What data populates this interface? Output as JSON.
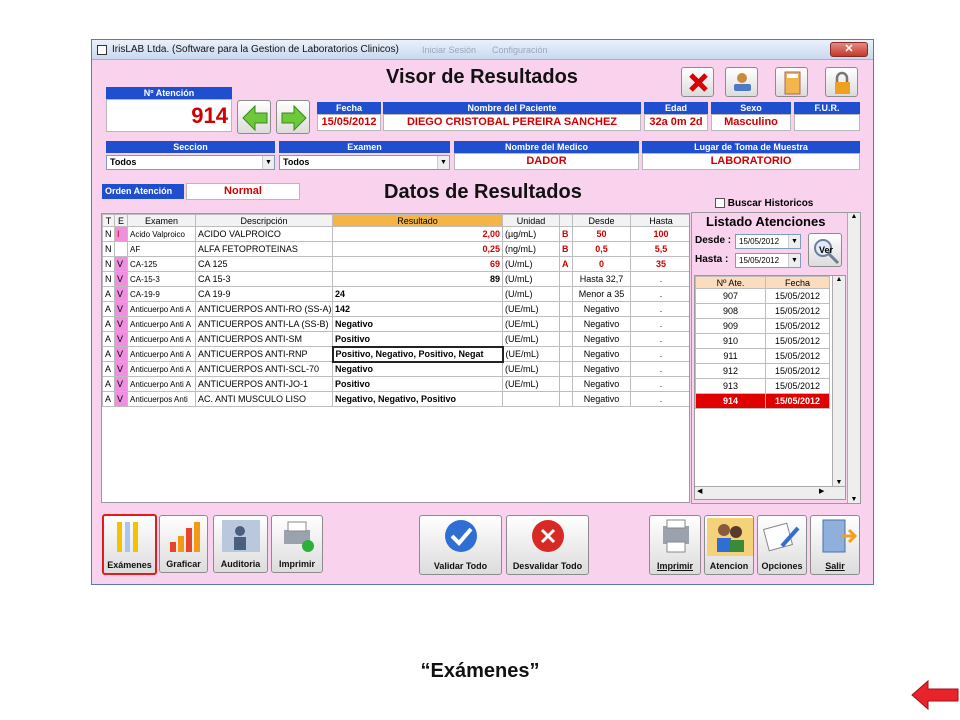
{
  "window": {
    "title": "IrisLAB Ltda. (Software para la Gestion de Laboratorios Clinicos)",
    "faded_1": "Iniciar Sesión",
    "faded_2": "Configuración",
    "close": "✕"
  },
  "header": {
    "title": "Visor de Resultados",
    "attention_label": "Nº Atención",
    "attention_value": "914",
    "fecha_label": "Fecha",
    "fecha_value": "15/05/2012",
    "patient_label": "Nombre del Paciente",
    "patient_value": "DIEGO CRISTOBAL PEREIRA SANCHEZ",
    "edad_label": "Edad",
    "edad_value": "32a 0m 2d",
    "sexo_label": "Sexo",
    "sexo_value": "Masculino",
    "fur_label": "F.U.R.",
    "fur_value": "",
    "seccion_label": "Seccion",
    "seccion_value": "Todos",
    "examen_label": "Examen",
    "examen_value": "Todos",
    "medico_label": "Nombre del Medico",
    "medico_value": "DADOR",
    "lugar_label": "Lugar de Toma de Muestra",
    "lugar_value": "LABORATORIO",
    "orden_label": "Orden Atención",
    "orden_value": "Normal"
  },
  "results": {
    "title": "Datos de Resultados",
    "columns": [
      "T",
      "E",
      "Examen",
      "Descripción",
      "Resultado",
      "Unidad",
      "",
      "Desde",
      "Hasta"
    ],
    "rows": [
      [
        "N",
        "I",
        "Acido Valproico",
        "ACIDO VALPROICO",
        "2,00",
        "(µg/mL)",
        "B",
        "50",
        "100"
      ],
      [
        "N",
        "",
        "AF",
        "ALFA FETOPROTEINAS",
        "0,25",
        "(ng/mL)",
        "B",
        "0,5",
        "5,5"
      ],
      [
        "N",
        "V",
        "CA-125",
        "CA 125",
        "69",
        "(U/mL)",
        "A",
        "0",
        "35"
      ],
      [
        "N",
        "V",
        "CA-15-3",
        "CA 15-3",
        "89",
        "(U/mL)",
        "",
        "Hasta 32,7",
        "."
      ],
      [
        "A",
        "V",
        "CA-19-9",
        "CA 19-9",
        "24",
        "(U/mL)",
        "",
        "Menor a 35",
        "."
      ],
      [
        "A",
        "V",
        "Anticuerpo Anti A",
        "ANTICUERPOS ANTI-RO (SS-A)",
        "142",
        "(UE/mL)",
        "",
        "Negativo",
        "."
      ],
      [
        "A",
        "V",
        "Anticuerpo Anti A",
        "ANTICUERPOS ANTI-LA (SS-B)",
        "Negativo",
        "(UE/mL)",
        "",
        "Negativo",
        "."
      ],
      [
        "A",
        "V",
        "Anticuerpo Anti A",
        "ANTICUERPOS ANTI-SM",
        "Positivo",
        "(UE/mL)",
        "",
        "Negativo",
        "."
      ],
      [
        "A",
        "V",
        "Anticuerpo Anti A",
        "ANTICUERPOS ANTI-RNP",
        "Positivo, Negativo, Positivo, Negat",
        "(UE/mL)",
        "",
        "Negativo",
        "."
      ],
      [
        "A",
        "V",
        "Anticuerpo Anti A",
        "ANTICUERPOS ANTI-SCL-70",
        "Negativo",
        "(UE/mL)",
        "",
        "Negativo",
        "."
      ],
      [
        "A",
        "V",
        "Anticuerpo Anti A",
        "ANTICUERPOS ANTI-JO-1",
        "Positivo",
        "(UE/mL)",
        "",
        "Negativo",
        "."
      ],
      [
        "A",
        "V",
        "Anticuerpos Anti",
        "AC. ANTI MUSCULO LISO",
        "Negativo, Negativo, Positivo",
        "",
        "",
        "Negativo",
        "."
      ]
    ]
  },
  "listado": {
    "buscar_label": "Buscar Historicos",
    "title": "Listado Atenciones",
    "desde_label": "Desde :",
    "desde_value": "15/05/2012",
    "hasta_label": "Hasta :",
    "hasta_value": "15/05/2012",
    "ver_label": "Ver",
    "columns": [
      "Nº Ate.",
      "Fecha"
    ],
    "rows": [
      [
        "907",
        "15/05/2012"
      ],
      [
        "908",
        "15/05/2012"
      ],
      [
        "909",
        "15/05/2012"
      ],
      [
        "910",
        "15/05/2012"
      ],
      [
        "911",
        "15/05/2012"
      ],
      [
        "912",
        "15/05/2012"
      ],
      [
        "913",
        "15/05/2012"
      ],
      [
        "914",
        "15/05/2012"
      ]
    ]
  },
  "toolbar": {
    "examenes": "Exámenes",
    "graficar": "Graficar",
    "auditoria": "Auditoria",
    "imprimir": "Imprimir",
    "validar": "Validar Todo",
    "desvalidar": "Desvalidar Todo",
    "imprimir2": "Imprimir",
    "atencion": "Atencion",
    "opciones": "Opciones",
    "salir": "Salir"
  },
  "caption": "“Exámenes”",
  "colors": {
    "accent_blue": "#1f4fcf",
    "value_red": "#d10000",
    "highlight_red": "#e00000",
    "panel_pink": "#f9d3ee"
  }
}
